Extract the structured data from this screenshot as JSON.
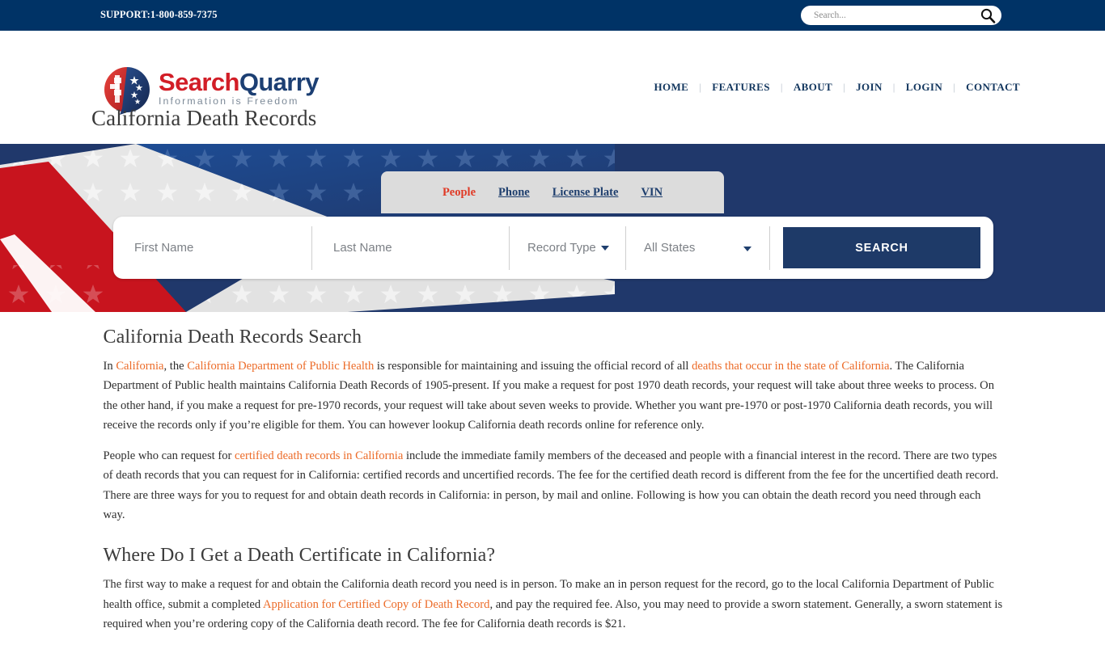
{
  "topbar": {
    "support": "SUPPORT:1-800-859-7375",
    "search_placeholder": "Search...",
    "search_value": "",
    "search_icon": "search-icon",
    "bg_color": "#003366"
  },
  "header": {
    "logo": {
      "name_part1": "Search",
      "name_part2": "Quarry",
      "tagline": "Information is Freedom",
      "red": "#d21e27",
      "blue": "#1c3f73"
    },
    "nav": [
      {
        "label": "HOME"
      },
      {
        "label": "FEATURES"
      },
      {
        "label": "ABOUT"
      },
      {
        "label": "JOIN"
      },
      {
        "label": "LOGIN"
      },
      {
        "label": "CONTACT"
      }
    ],
    "nav_separator": "|"
  },
  "page_title": "California Death Records",
  "hero": {
    "bg_color": "#20386b",
    "tabs": [
      {
        "label": "People",
        "active": true
      },
      {
        "label": "Phone",
        "active": false
      },
      {
        "label": "License Plate",
        "active": false
      },
      {
        "label": "VIN",
        "active": false
      }
    ],
    "form": {
      "first_name_placeholder": "First Name",
      "first_name_value": "",
      "last_name_placeholder": "Last Name",
      "last_name_value": "",
      "record_type_label": "Record Type",
      "states_label": "All States",
      "search_button": "SEARCH",
      "button_color": "#1e3a68"
    }
  },
  "main": {
    "heading1": "California Death Records Search",
    "p1_seg1": "In ",
    "p1_link1": "California",
    "p1_seg2": ", the ",
    "p1_link2": "California Department of Public Health",
    "p1_seg3": " is responsible for maintaining and issuing the official record of all ",
    "p1_link3": "deaths that occur in the state of California",
    "p1_seg4": ". The California Department of Public health maintains California Death Records of 1905-present. If you make a request for post 1970 death records, your request will take about three weeks to process. On the other hand, if you make a request for pre-1970 records, your request will take about seven weeks to provide. Whether you want pre-1970 or post-1970 California death records, you will receive the records only if you’re eligible for them. You can however lookup California death records online for reference only.",
    "p2_seg1": "People who can request for ",
    "p2_link1": "certified death records in California",
    "p2_seg2": " include the immediate family members of the deceased and people with a financial interest in the record. There are two types of death records that you can request for in California: certified records and uncertified records. The fee for the certified death record is different from the fee for the uncertified death record. There are three ways for you to request for and obtain death records in California: in person, by mail and online. Following is how you can obtain the death record you need through each way.",
    "heading2": "Where Do I Get a Death Certificate in California?",
    "p3_seg1": "The first way to make a request for and obtain the California death record you need is in person. To make an in person request for the record, go to the local California Department of Public health office, submit a completed ",
    "p3_link1": "Application for Certified Copy of Death Record",
    "p3_seg2": ", and pay the required fee. Also, you may need to provide a sworn statement. Generally, a sworn statement is required when you’re ordering copy of the California death record. The fee for California death records is $21.",
    "link_color": "#ec6b28"
  }
}
